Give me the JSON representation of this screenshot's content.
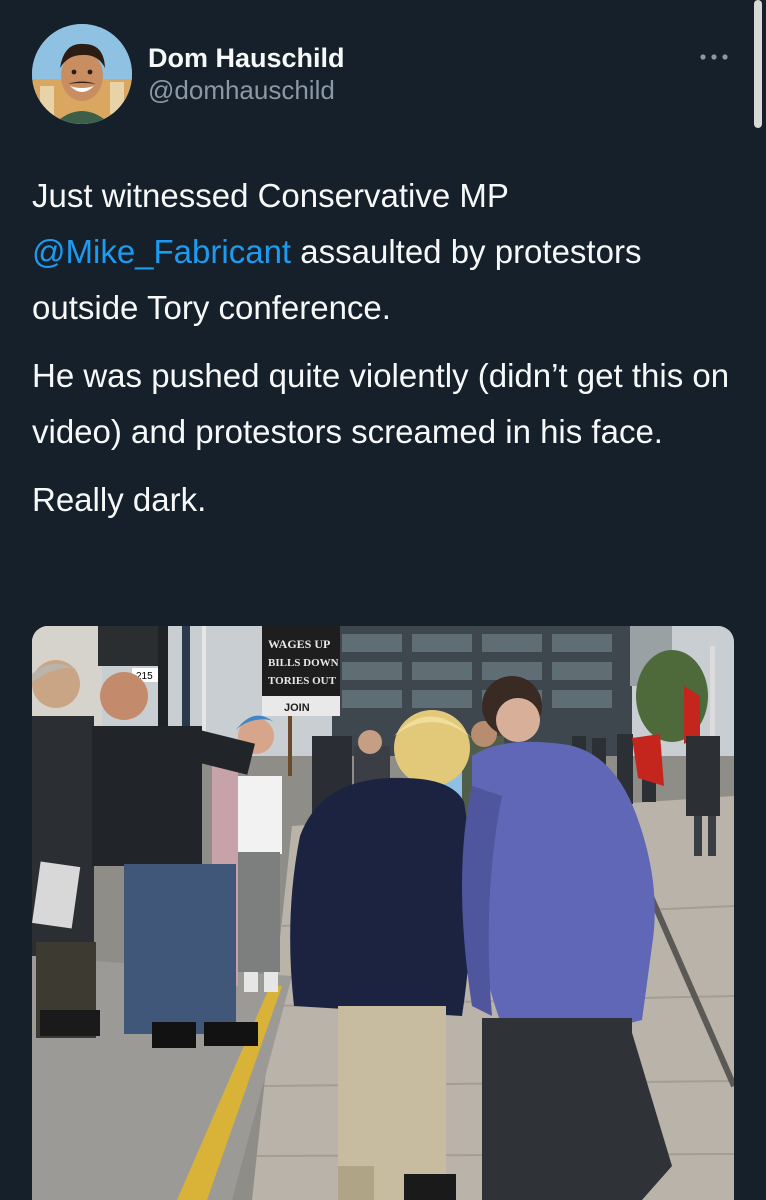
{
  "author": {
    "display_name": "Dom Hauschild",
    "handle": "@domhauschild"
  },
  "more_menu_icon": "ellipsis-icon",
  "tweet": {
    "para1": {
      "before": "Just witnessed Conservative MP ",
      "mention": "@Mike_Fabricant",
      "after": " assaulted by protestors outside Tory conference."
    },
    "para2": "He was pushed quite violently (didn’t get this on video) and protestors screamed in his face.",
    "para3": "Really dark."
  },
  "media": {
    "sign_text": [
      "WAGES UP",
      "BILLS DOWN",
      "TORIES OUT"
    ],
    "sign_strip": "JOIN",
    "plate_text": "215"
  },
  "colors": {
    "background": "#15202b",
    "mention": "#1d9bf0",
    "handle": "#8b98a5"
  }
}
